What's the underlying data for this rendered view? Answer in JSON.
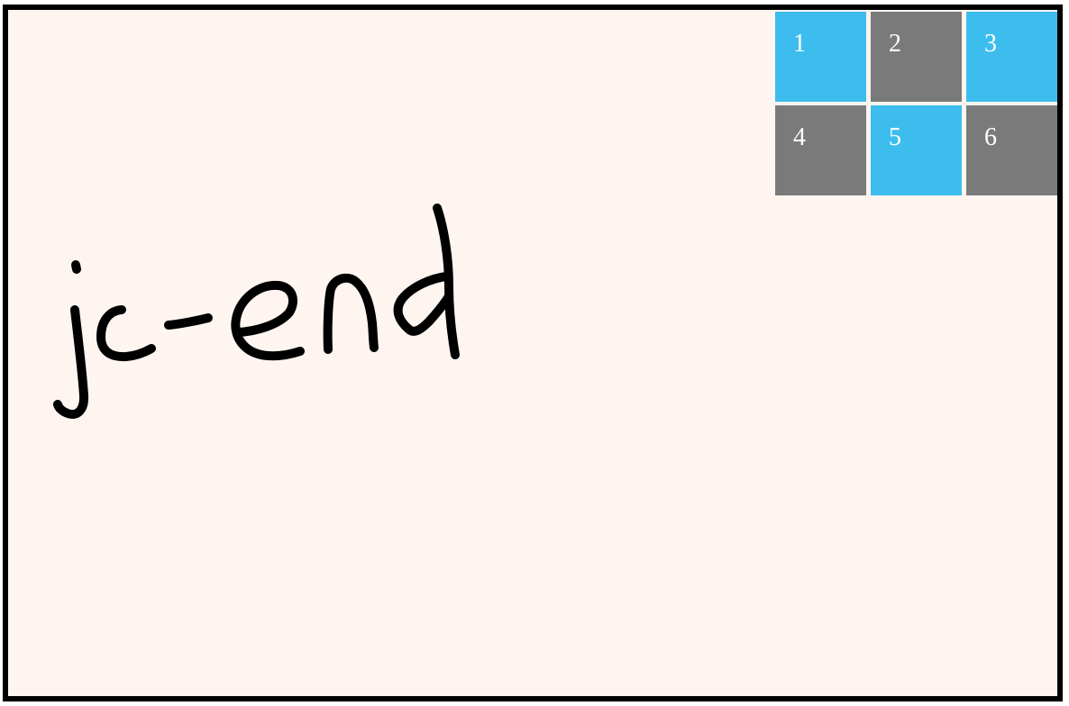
{
  "canvas": {
    "background": "#fff5f0",
    "border_color": "#000000",
    "handwritten_text": "jc-end"
  },
  "flex_container": {
    "items": [
      {
        "label": "1",
        "color": "#3dbdee"
      },
      {
        "label": "2",
        "color": "#7a7a7a"
      },
      {
        "label": "3",
        "color": "#3dbdee"
      },
      {
        "label": "4",
        "color": "#7a7a7a"
      },
      {
        "label": "5",
        "color": "#3dbdee"
      },
      {
        "label": "6",
        "color": "#7a7a7a"
      }
    ]
  }
}
